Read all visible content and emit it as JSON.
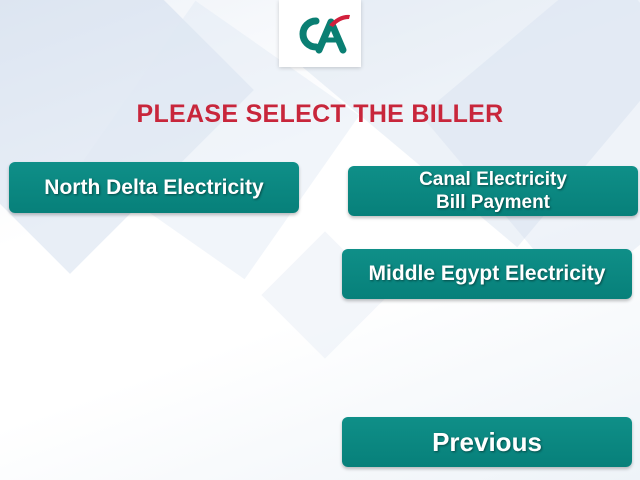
{
  "header": {
    "logo": {
      "text": "CA",
      "colors": {
        "green": "#0a7f73",
        "red": "#d21f3c"
      }
    },
    "title": "PLEASE SELECT THE BILLER"
  },
  "billers": {
    "north_delta": "North Delta Electricity",
    "canal_line1": "Canal Electricity",
    "canal_line2": "Bill Payment",
    "middle_egypt": "Middle Egypt Electricity"
  },
  "navigation": {
    "previous": "Previous"
  },
  "colors": {
    "button": "#0a8a84",
    "title": "#c8263b",
    "button_text": "#ffffff"
  }
}
